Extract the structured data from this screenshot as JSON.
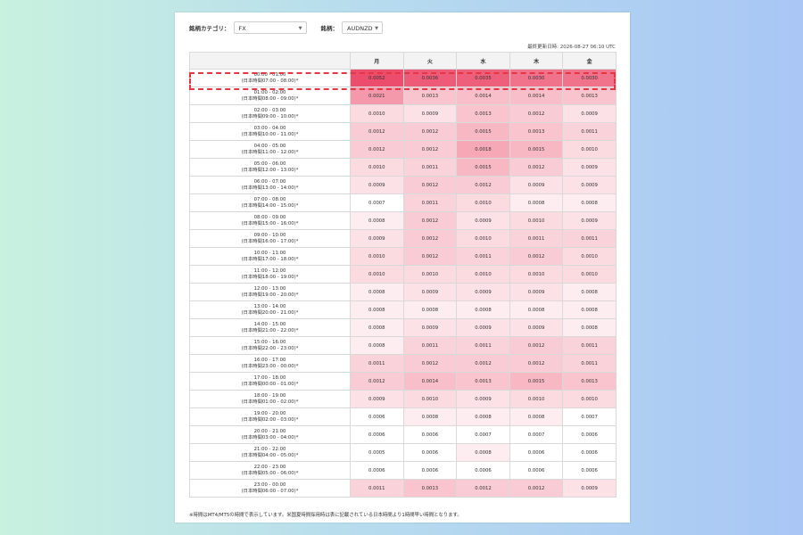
{
  "filters": {
    "category_label": "銘柄カテゴリ：",
    "category_value": "FX",
    "symbol_label": "銘柄：",
    "symbol_value": "AUDNZD"
  },
  "updated_at": "最終更新日時: 2026-08-27 06:10 UTC",
  "table": {
    "headers": [
      "月",
      "火",
      "水",
      "木",
      "金"
    ],
    "rows": [
      {
        "time": "00:00 - 01:00",
        "jst": "(日本時間07:00 - 08:00)*",
        "values": [
          "0.0052",
          "0.0036",
          "0.0035",
          "0.0030",
          "0.0030"
        ]
      },
      {
        "time": "01:00 - 02:00",
        "jst": "(日本時間08:00 - 09:00)*",
        "values": [
          "0.0021",
          "0.0013",
          "0.0014",
          "0.0014",
          "0.0013"
        ]
      },
      {
        "time": "02:00 - 03:00",
        "jst": "(日本時間09:00 - 10:00)*",
        "values": [
          "0.0010",
          "0.0009",
          "0.0013",
          "0.0012",
          "0.0009"
        ]
      },
      {
        "time": "03:00 - 04:00",
        "jst": "(日本時間10:00 - 11:00)*",
        "values": [
          "0.0012",
          "0.0012",
          "0.0015",
          "0.0013",
          "0.0011"
        ]
      },
      {
        "time": "04:00 - 05:00",
        "jst": "(日本時間11:00 - 12:00)*",
        "values": [
          "0.0012",
          "0.0012",
          "0.0018",
          "0.0015",
          "0.0010"
        ]
      },
      {
        "time": "05:00 - 06:00",
        "jst": "(日本時間12:00 - 13:00)*",
        "values": [
          "0.0010",
          "0.0011",
          "0.0015",
          "0.0012",
          "0.0009"
        ]
      },
      {
        "time": "06:00 - 07:00",
        "jst": "(日本時間13:00 - 14:00)*",
        "values": [
          "0.0009",
          "0.0012",
          "0.0012",
          "0.0009",
          "0.0009"
        ]
      },
      {
        "time": "07:00 - 08:00",
        "jst": "(日本時間14:00 - 15:00)*",
        "values": [
          "0.0007",
          "0.0011",
          "0.0010",
          "0.0008",
          "0.0008"
        ]
      },
      {
        "time": "08:00 - 09:00",
        "jst": "(日本時間15:00 - 16:00)*",
        "values": [
          "0.0008",
          "0.0012",
          "0.0009",
          "0.0010",
          "0.0009"
        ]
      },
      {
        "time": "09:00 - 10:00",
        "jst": "(日本時間16:00 - 17:00)*",
        "values": [
          "0.0009",
          "0.0012",
          "0.0010",
          "0.0011",
          "0.0011"
        ]
      },
      {
        "time": "10:00 - 11:00",
        "jst": "(日本時間17:00 - 18:00)*",
        "values": [
          "0.0010",
          "0.0012",
          "0.0011",
          "0.0012",
          "0.0010"
        ]
      },
      {
        "time": "11:00 - 12:00",
        "jst": "(日本時間18:00 - 19:00)*",
        "values": [
          "0.0010",
          "0.0010",
          "0.0010",
          "0.0010",
          "0.0010"
        ]
      },
      {
        "time": "12:00 - 13:00",
        "jst": "(日本時間19:00 - 20:00)*",
        "values": [
          "0.0008",
          "0.0009",
          "0.0009",
          "0.0009",
          "0.0008"
        ]
      },
      {
        "time": "13:00 - 14:00",
        "jst": "(日本時間20:00 - 21:00)*",
        "values": [
          "0.0008",
          "0.0008",
          "0.0008",
          "0.0008",
          "0.0008"
        ]
      },
      {
        "time": "14:00 - 15:00",
        "jst": "(日本時間21:00 - 22:00)*",
        "values": [
          "0.0008",
          "0.0009",
          "0.0009",
          "0.0009",
          "0.0008"
        ]
      },
      {
        "time": "15:00 - 16:00",
        "jst": "(日本時間22:00 - 23:00)*",
        "values": [
          "0.0008",
          "0.0011",
          "0.0011",
          "0.0012",
          "0.0011"
        ]
      },
      {
        "time": "16:00 - 17:00",
        "jst": "(日本時間23:00 - 00:00)*",
        "values": [
          "0.0011",
          "0.0012",
          "0.0012",
          "0.0012",
          "0.0011"
        ]
      },
      {
        "time": "17:00 - 18:00",
        "jst": "(日本時間00:00 - 01:00)*",
        "values": [
          "0.0012",
          "0.0014",
          "0.0013",
          "0.0015",
          "0.0013"
        ]
      },
      {
        "time": "18:00 - 19:00",
        "jst": "(日本時間01:00 - 02:00)*",
        "values": [
          "0.0009",
          "0.0010",
          "0.0009",
          "0.0010",
          "0.0010"
        ]
      },
      {
        "time": "19:00 - 20:00",
        "jst": "(日本時間02:00 - 03:00)*",
        "values": [
          "0.0006",
          "0.0008",
          "0.0008",
          "0.0008",
          "0.0007"
        ]
      },
      {
        "time": "20:00 - 21:00",
        "jst": "(日本時間03:00 - 04:00)*",
        "values": [
          "0.0006",
          "0.0006",
          "0.0007",
          "0.0007",
          "0.0006"
        ]
      },
      {
        "time": "21:00 - 22:00",
        "jst": "(日本時間04:00 - 05:00)*",
        "values": [
          "0.0005",
          "0.0006",
          "0.0008",
          "0.0006",
          "0.0006"
        ]
      },
      {
        "time": "22:00 - 23:00",
        "jst": "(日本時間05:00 - 06:00)*",
        "values": [
          "0.0006",
          "0.0006",
          "0.0006",
          "0.0006",
          "0.0006"
        ]
      },
      {
        "time": "23:00 - 00:00",
        "jst": "(日本時間06:00 - 07:00)*",
        "values": [
          "0.0011",
          "0.0013",
          "0.0012",
          "0.0012",
          "0.0009"
        ]
      }
    ]
  },
  "note": "※時間はMT4/MT5の時間で表示しています。米国夏時間採用時は表に記載されている日本時間より1時間早い時間となります。",
  "colors": {
    "highlight": "#e43744",
    "heat_low": "#ffffff",
    "heat_high": "#ec4d6c"
  }
}
